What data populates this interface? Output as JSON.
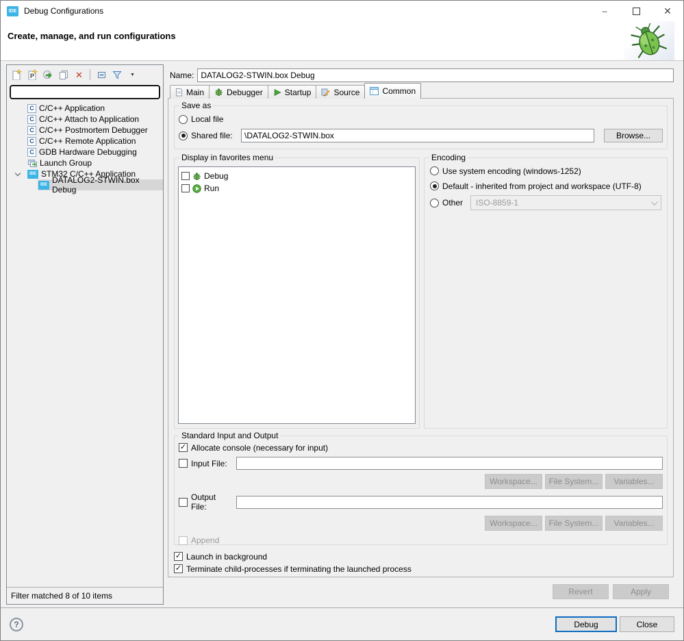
{
  "window": {
    "title": "Debug Configurations",
    "app_badge": "IDE",
    "controls": {
      "minimize": "–",
      "close": "✕"
    }
  },
  "header": {
    "title": "Create, manage, and run configurations"
  },
  "sidebar": {
    "filter_input": {
      "value": "",
      "placeholder": ""
    },
    "tree": [
      {
        "label": "C/C++ Application"
      },
      {
        "label": "C/C++ Attach to Application"
      },
      {
        "label": "C/C++ Postmortem Debugger"
      },
      {
        "label": "C/C++ Remote Application"
      },
      {
        "label": "GDB Hardware Debugging"
      },
      {
        "label": "Launch Group"
      },
      {
        "label": "STM32 C/C++ Application",
        "badge": "IDE"
      },
      {
        "label": "DATALOG2-STWIN.box Debug",
        "badge": "IDE"
      }
    ],
    "status": "Filter matched 8 of 10 items"
  },
  "main": {
    "name_label": "Name:",
    "name_value": "DATALOG2-STWIN.box Debug",
    "tabs": [
      {
        "label": "Main"
      },
      {
        "label": "Debugger"
      },
      {
        "label": "Startup"
      },
      {
        "label": "Source"
      },
      {
        "label": "Common"
      }
    ],
    "save_as": {
      "legend": "Save as",
      "local_label": "Local file",
      "shared_label": "Shared file:",
      "shared_value": "\\DATALOG2-STWIN.box",
      "browse_label": "Browse..."
    },
    "favorites": {
      "legend": "Display in favorites menu",
      "items": [
        {
          "label": "Debug"
        },
        {
          "label": "Run"
        }
      ]
    },
    "encoding": {
      "legend": "Encoding",
      "system_label": "Use system encoding (windows-1252)",
      "default_label": "Default - inherited from project and workspace (UTF-8)",
      "other_label": "Other",
      "other_value": "ISO-8859-1"
    },
    "stdio": {
      "legend": "Standard Input and Output",
      "allocate_label": "Allocate console (necessary for input)",
      "input_label": "Input File:",
      "input_value": "",
      "output_label": "Output File:",
      "output_value": "",
      "append_label": "Append",
      "workspace_label": "Workspace...",
      "filesystem_label": "File System...",
      "variables_label": "Variables..."
    },
    "launch_bg_label": "Launch in background",
    "terminate_label": "Terminate child-processes if terminating the launched process",
    "revert_label": "Revert",
    "apply_label": "Apply"
  },
  "footer": {
    "help": "?",
    "debug_label": "Debug",
    "close_label": "Close"
  },
  "colors": {
    "accent_blue": "#3CB4E6",
    "focus_blue": "#0D6CC0",
    "selection_gray": "#D6D6D6"
  }
}
